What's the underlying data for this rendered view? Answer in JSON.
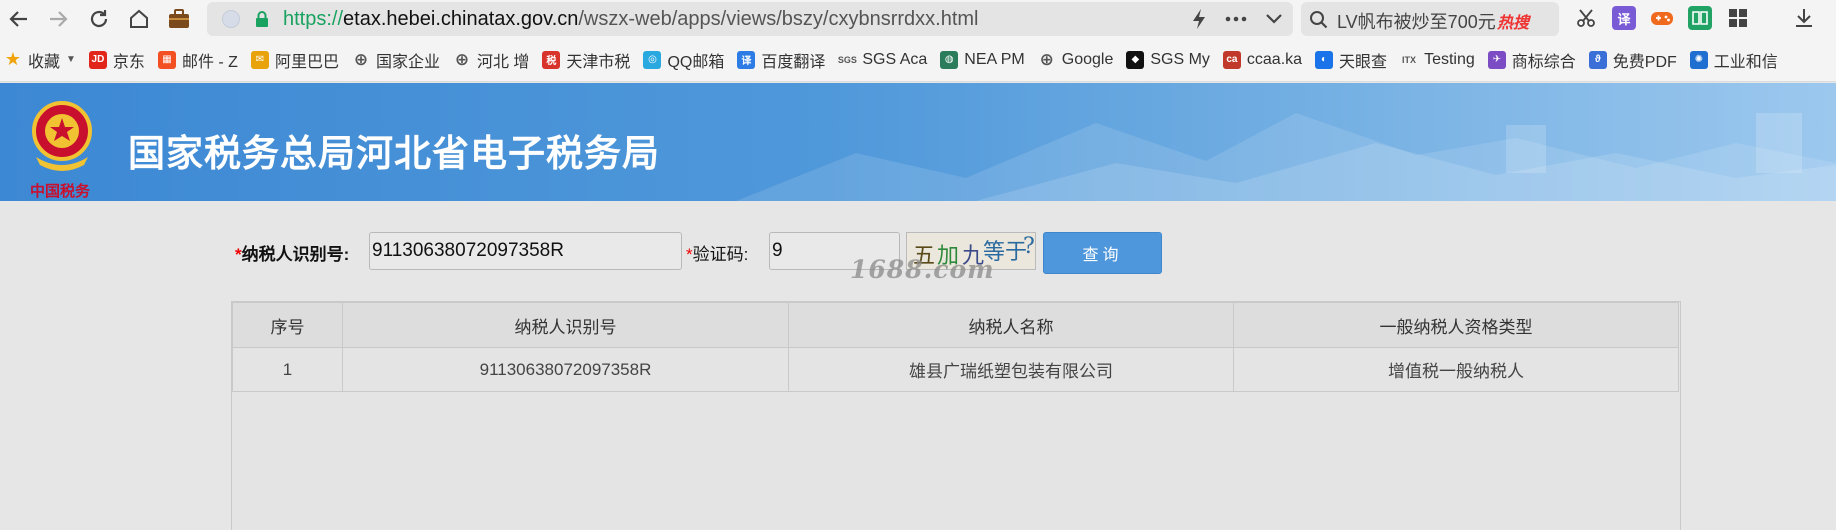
{
  "browser": {
    "url": {
      "scheme": "https://",
      "host": "etax.hebei.chinatax.gov.cn",
      "path": "/wszx-web/apps/views/bszy/cxybnsrrdxx.html"
    },
    "search": {
      "text": "LV帆布被炒至700元",
      "hot_tag": "热搜"
    },
    "toolbar": {
      "translate_label": "译"
    }
  },
  "bookmarks": [
    {
      "icon": "star-icon",
      "label": "收藏",
      "color": "#f0a30a",
      "glyph": "★"
    },
    {
      "icon": "jd-icon",
      "label": "京东",
      "color": "#e1251b",
      "glyph": "JD"
    },
    {
      "icon": "windows-icon",
      "label": "邮件 - Z",
      "color": "#f25022",
      "glyph": "▦"
    },
    {
      "icon": "alibaba-icon",
      "label": "阿里巴巴",
      "color": "#e8a30c",
      "glyph": "✉"
    },
    {
      "icon": "globe-icon",
      "label": "国家企业",
      "color": "none",
      "glyph": "⊕"
    },
    {
      "icon": "globe-icon",
      "label": "河北 增",
      "color": "none",
      "glyph": "⊕"
    },
    {
      "icon": "tax-icon",
      "label": "天津市税",
      "color": "#d9342b",
      "glyph": "税"
    },
    {
      "icon": "qqmail-icon",
      "label": "QQ邮箱",
      "color": "#2aa8e0",
      "glyph": "◎"
    },
    {
      "icon": "baidu-translate-icon",
      "label": "百度翻译",
      "color": "#2d7be5",
      "glyph": "译"
    },
    {
      "icon": "sgs-icon",
      "label": "SGS Aca",
      "color": "none",
      "glyph": "SGS"
    },
    {
      "icon": "nea-icon",
      "label": "NEA PM",
      "color": "#2a7c5a",
      "glyph": "◍"
    },
    {
      "icon": "globe-icon",
      "label": "Google",
      "color": "none",
      "glyph": "⊕"
    },
    {
      "icon": "sgs-my-icon",
      "label": "SGS My",
      "color": "#111111",
      "glyph": "◆"
    },
    {
      "icon": "ccaa-icon",
      "label": "ccaa.ka",
      "color": "#c0392b",
      "glyph": "ca"
    },
    {
      "icon": "tianyancha-icon",
      "label": "天眼查",
      "color": "#1a73e8",
      "glyph": "◐"
    },
    {
      "icon": "itx-icon",
      "label": "Testing",
      "color": "none",
      "glyph": "ITX"
    },
    {
      "icon": "trademark-icon",
      "label": "商标综合",
      "color": "#7b4cc4",
      "glyph": "✈"
    },
    {
      "icon": "pdf-icon",
      "label": "免费PDF",
      "color": "#3a6fd8",
      "glyph": "ϑ"
    },
    {
      "icon": "ministry-icon",
      "label": "工业和信",
      "color": "#1f6fd1",
      "glyph": "✺"
    }
  ],
  "site": {
    "title": "国家税务总局河北省电子税务局",
    "emblem_subtitle": "中国税务"
  },
  "form": {
    "taxpayer_id_label": "纳税人识别号:",
    "taxpayer_id_value": "91130638072097358R",
    "captcha_label": "验证码:",
    "captcha_value": "9",
    "captcha_chars": [
      "五",
      "加",
      "九",
      "等于",
      "?"
    ],
    "query_button": "查询",
    "required_mark": "*"
  },
  "watermark": "1688.com",
  "table": {
    "headers": [
      "序号",
      "纳税人识别号",
      "纳税人名称",
      "一般纳税人资格类型"
    ],
    "rows": [
      [
        "1",
        "91130638072097358R",
        "雄县广瑞纸塑包装有限公司",
        "增值税一般纳税人"
      ]
    ]
  },
  "colors": {
    "accent": "#4f97dd",
    "required": "#e00000",
    "url_scheme": "#1aa260"
  }
}
